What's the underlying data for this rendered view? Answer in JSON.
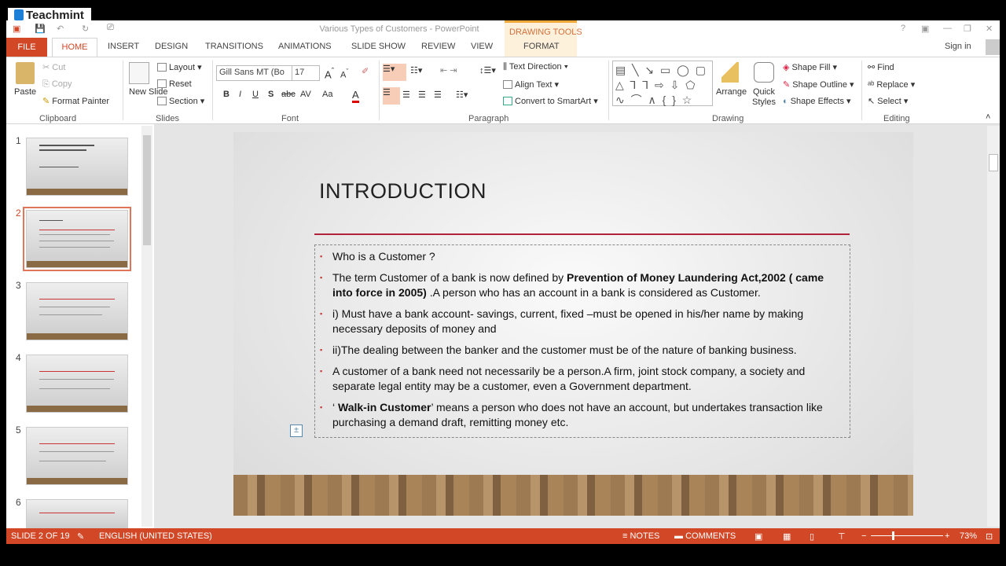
{
  "overlay": {
    "brand": "Teachmint"
  },
  "window": {
    "title": "Various Types of Customers - PowerPoint",
    "contextual_tab": "DRAWING TOOLS",
    "sign_in": "Sign in",
    "controls": [
      "?",
      "▣",
      "—",
      "❐",
      "✕"
    ]
  },
  "tabs": [
    "FILE",
    "HOME",
    "INSERT",
    "DESIGN",
    "TRANSITIONS",
    "ANIMATIONS",
    "SLIDE SHOW",
    "REVIEW",
    "VIEW",
    "FORMAT"
  ],
  "ribbon": {
    "clipboard": {
      "label": "Clipboard",
      "paste": "Paste",
      "cut": "Cut",
      "copy": "Copy",
      "format_painter": "Format Painter"
    },
    "slides": {
      "label": "Slides",
      "new_slide": "New Slide",
      "layout": "Layout",
      "reset": "Reset",
      "section": "Section"
    },
    "font": {
      "label": "Font",
      "font_name": "Gill Sans MT (Bo",
      "font_size": "17",
      "bold": "B",
      "italic": "I",
      "underline": "U",
      "shadow": "S",
      "strike": "abc",
      "spacing": "AV",
      "case": "Aa",
      "color": "A"
    },
    "paragraph": {
      "label": "Paragraph",
      "text_direction": "Text Direction",
      "align_text": "Align Text",
      "smartart": "Convert to SmartArt"
    },
    "drawing": {
      "label": "Drawing",
      "arrange": "Arrange",
      "quick_styles": "Quick Styles",
      "shape_fill": "Shape Fill",
      "shape_outline": "Shape Outline",
      "shape_effects": "Shape Effects",
      "shapes": "▤ ╲ ↘ ▭ ◯ ▢ △ ⅂ ⅂ ⇨ ⇩ ⬠ ∿ ⌒ ∧ { } ☆"
    },
    "editing": {
      "label": "Editing",
      "find": "Find",
      "replace": "Replace",
      "select": "Select"
    }
  },
  "thumbnails": [
    "1",
    "2",
    "3",
    "4",
    "5",
    "6"
  ],
  "slide": {
    "title": "INTRODUCTION",
    "bullets": [
      {
        "pre": "",
        "bold": "",
        "text": "Who is a Customer ?"
      },
      {
        "pre": "The term Customer of a bank is now defined by ",
        "bold": "Prevention of Money Laundering Act,2002 ( came into force in 2005)",
        "text": " .A person who has an account in a bank is considered as Customer."
      },
      {
        "pre": "",
        "bold": "",
        "text": "i) Must have a bank account- savings, current, fixed –must be opened in his/her name by making necessary deposits of money and"
      },
      {
        "pre": "",
        "bold": "",
        "text": "ii)The dealing between the banker and the customer must be of the nature of banking business."
      },
      {
        "pre": "",
        "bold": "",
        "text": "A customer of a bank need not necessarily be a person.A firm, joint stock company, a society and separate legal entity may be a customer, even a Government department."
      },
      {
        "pre": "‘ ",
        "bold": "Walk-in Customer",
        "text": "’ means a person who does not have an account, but undertakes transaction like purchasing a demand draft, remitting money etc."
      }
    ]
  },
  "status": {
    "slide": "SLIDE 2 OF 19",
    "language": "ENGLISH (UNITED STATES)",
    "notes": "NOTES",
    "comments": "COMMENTS",
    "zoom": "73%",
    "minus": "−",
    "plus": "+"
  },
  "colors": {
    "accent": "#d24726",
    "title_rule": "#b3213a"
  }
}
